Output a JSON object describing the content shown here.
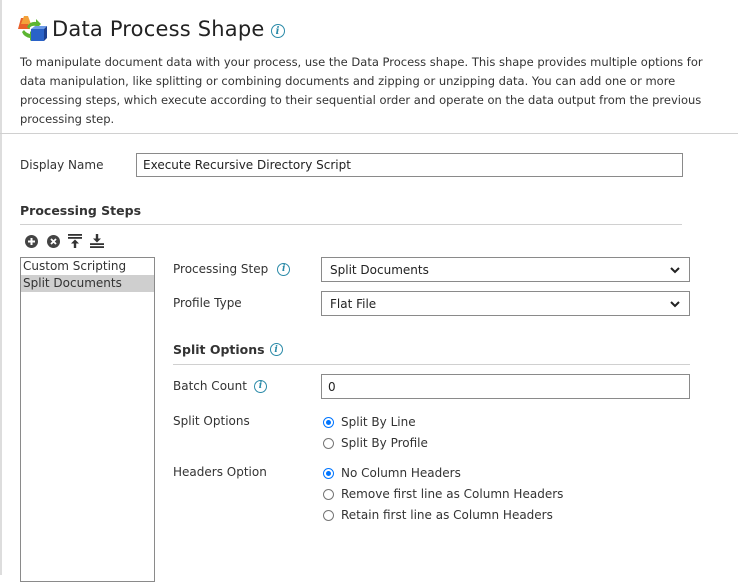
{
  "header": {
    "title": "Data Process Shape",
    "title_icon": "data-process-shape-icon",
    "info_icon": "info-icon",
    "description": "To manipulate document data with your process, use the Data Process shape. This shape provides multiple options for data manipulation, like splitting or combining documents and zipping or unzipping data. You can add one or more processing steps, which execute according to their sequential order and operate on the data output from the previous processing step."
  },
  "display_name": {
    "label": "Display Name",
    "value": "Execute Recursive Directory Script"
  },
  "processing_steps": {
    "title": "Processing Steps",
    "toolbar": [
      {
        "name": "add-step",
        "icon": "plus-circle-icon"
      },
      {
        "name": "remove-step",
        "icon": "x-circle-icon"
      },
      {
        "name": "move-to-top",
        "icon": "move-top-icon"
      },
      {
        "name": "move-to-bottom",
        "icon": "move-bottom-icon"
      }
    ],
    "items": [
      {
        "label": "Custom Scripting",
        "selected": false
      },
      {
        "label": "Split Documents",
        "selected": true
      }
    ]
  },
  "step_config": {
    "processing_step": {
      "label": "Processing Step",
      "value": "Split Documents"
    },
    "profile_type": {
      "label": "Profile Type",
      "value": "Flat File"
    },
    "split_options_section": {
      "title": "Split Options"
    },
    "batch_count": {
      "label": "Batch Count",
      "value": "0"
    },
    "split_options": {
      "label": "Split Options",
      "options": [
        {
          "label": "Split By Line",
          "checked": true
        },
        {
          "label": "Split By Profile",
          "checked": false
        }
      ]
    },
    "headers_option": {
      "label": "Headers Option",
      "options": [
        {
          "label": "No Column Headers",
          "checked": true
        },
        {
          "label": "Remove first line as Column Headers",
          "checked": false
        },
        {
          "label": "Retain first line as Column Headers",
          "checked": false
        }
      ]
    }
  },
  "colors": {
    "info_accent": "#2a8aa8",
    "radio_accent": "#0075ff",
    "selected_item_bg": "#cfcfcf"
  }
}
